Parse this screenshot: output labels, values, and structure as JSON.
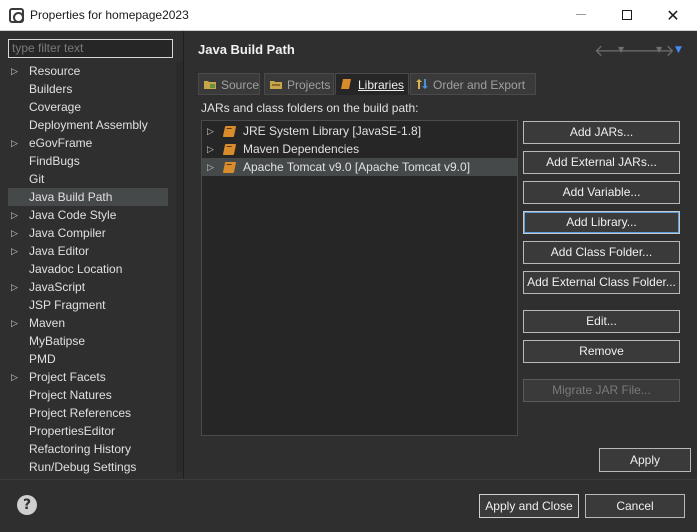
{
  "window": {
    "title": "Properties for homepage2023",
    "minimize_label": "",
    "close_label": "✕"
  },
  "filter": {
    "placeholder": "type filter text"
  },
  "tree": {
    "items": [
      {
        "label": "Resource",
        "expandable": true
      },
      {
        "label": "Builders",
        "expandable": false
      },
      {
        "label": "Coverage",
        "expandable": false
      },
      {
        "label": "Deployment Assembly",
        "expandable": false
      },
      {
        "label": "eGovFrame",
        "expandable": true
      },
      {
        "label": "FindBugs",
        "expandable": false
      },
      {
        "label": "Git",
        "expandable": false
      },
      {
        "label": "Java Build Path",
        "expandable": false,
        "selected": true
      },
      {
        "label": "Java Code Style",
        "expandable": true
      },
      {
        "label": "Java Compiler",
        "expandable": true
      },
      {
        "label": "Java Editor",
        "expandable": true
      },
      {
        "label": "Javadoc Location",
        "expandable": false
      },
      {
        "label": "JavaScript",
        "expandable": true
      },
      {
        "label": "JSP Fragment",
        "expandable": false
      },
      {
        "label": "Maven",
        "expandable": true
      },
      {
        "label": "MyBatipse",
        "expandable": false
      },
      {
        "label": "PMD",
        "expandable": false
      },
      {
        "label": "Project Facets",
        "expandable": true
      },
      {
        "label": "Project Natures",
        "expandable": false
      },
      {
        "label": "Project References",
        "expandable": false
      },
      {
        "label": "PropertiesEditor",
        "expandable": false
      },
      {
        "label": "Refactoring History",
        "expandable": false
      },
      {
        "label": "Run/Debug Settings",
        "expandable": false
      }
    ]
  },
  "page": {
    "title": "Java Build Path",
    "tabs": [
      {
        "label": "Source",
        "active": false
      },
      {
        "label": "Projects",
        "active": false
      },
      {
        "label": "Libraries",
        "active": true
      },
      {
        "label": "Order and Export",
        "active": false
      }
    ],
    "subtitle": "JARs and class folders on the build path:",
    "libraries": [
      {
        "label": "JRE System Library [JavaSE-1.8]",
        "selected": false
      },
      {
        "label": "Maven Dependencies",
        "selected": false
      },
      {
        "label": "Apache Tomcat v9.0 [Apache Tomcat v9.0]",
        "selected": true
      }
    ],
    "buttons": {
      "add_jars": "Add JARs...",
      "add_external_jars": "Add External JARs...",
      "add_variable": "Add Variable...",
      "add_library": "Add Library...",
      "add_class_folder": "Add Class Folder...",
      "add_external_class_folder": "Add External Class Folder...",
      "edit": "Edit...",
      "remove": "Remove",
      "migrate_jar": "Migrate JAR File..."
    },
    "apply": "Apply"
  },
  "bottom": {
    "help": "?",
    "apply_and_close": "Apply and Close",
    "cancel": "Cancel"
  },
  "colors": {
    "background": "#2f2f2f",
    "selection": "#45494a",
    "focus_ring": "#5a9fe0",
    "library_icon": "#d98c2b"
  }
}
